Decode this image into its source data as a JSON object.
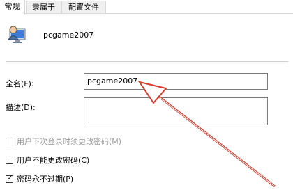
{
  "tabs": [
    {
      "label": "常规"
    },
    {
      "label": "隶属于"
    },
    {
      "label": "配置文件"
    }
  ],
  "user": {
    "name": "pcgame2007"
  },
  "fields": {
    "fullname_label": "全名(F):",
    "fullname_value": "pcgame2007",
    "description_label": "描述(D):",
    "description_value": ""
  },
  "checkboxes": [
    {
      "label": "用户下次登录时须更改密码(M)",
      "checked": false,
      "disabled": true
    },
    {
      "label": "用户不能更改密码(C)",
      "checked": false,
      "disabled": false
    },
    {
      "label": "密码永不过期(P)",
      "checked": true,
      "disabled": false
    }
  ],
  "colors": {
    "annotation_arrow": "#d93a2b"
  }
}
